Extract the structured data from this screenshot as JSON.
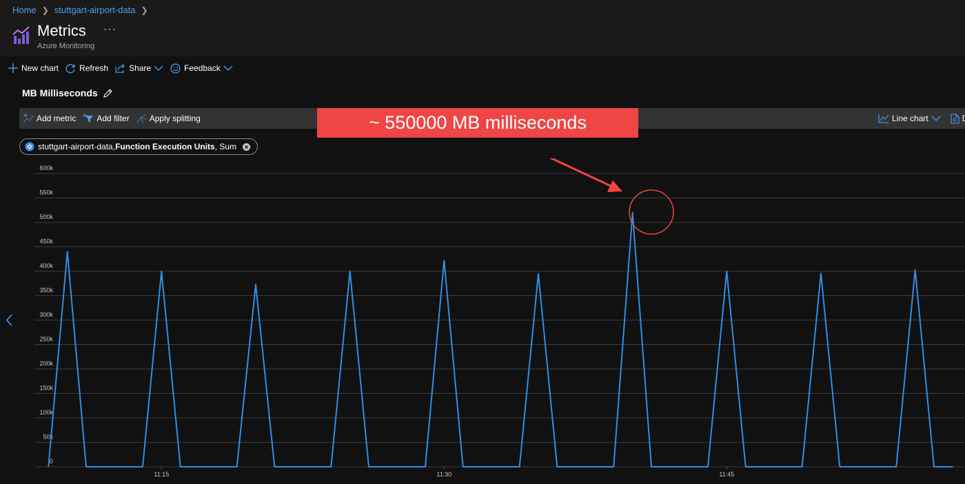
{
  "breadcrumb": {
    "home": "Home",
    "resource": "stuttgart-airport-data"
  },
  "header": {
    "title": "Metrics",
    "subtitle": "Azure Monitoring",
    "more": "···"
  },
  "commands": {
    "new_chart": "New chart",
    "refresh": "Refresh",
    "share": "Share",
    "feedback": "Feedback"
  },
  "chart_title": "MB Milliseconds",
  "toolbar": {
    "add_metric": "Add metric",
    "add_filter": "Add filter",
    "apply_splitting": "Apply splitting",
    "chart_type": "Line chart",
    "overflow_label": "D"
  },
  "metric_pill": {
    "resource": "stuttgart-airport-data,",
    "metric": "Function Execution Units",
    "aggregation": ", Sum"
  },
  "callout": {
    "text": "~ 550000 MB milliseconds"
  },
  "colors": {
    "accent": "#4aa0f0",
    "series": "#2f8fe8",
    "callout": "#f04545"
  },
  "chart_data": {
    "type": "line",
    "title": "",
    "ylim": [
      0,
      600000
    ],
    "y_ticks": [
      "0",
      "50k",
      "100k",
      "150k",
      "200k",
      "250k",
      "300k",
      "350k",
      "400k",
      "450k",
      "500k",
      "550k",
      "600k"
    ],
    "x_ticks": [
      "11:15",
      "11:30",
      "11:45"
    ],
    "x_tick_minutes": [
      15,
      30,
      45
    ],
    "grid": true,
    "series": [
      {
        "x_minutes": [
          9.0,
          10.0,
          11.0,
          12.0,
          14.0,
          15.0,
          16.0,
          17.0,
          19.0,
          20.0,
          21.0,
          22.0,
          24.0,
          25.0,
          26.0,
          27.0,
          29.0,
          30.0,
          31.0,
          32.0,
          34.0,
          35.0,
          36.0,
          37.0,
          39.0,
          40.0,
          41.0,
          42.0,
          44.0,
          45.0,
          46.0,
          47.0,
          49.0,
          50.0,
          51.0,
          52.0,
          54.0,
          55.0,
          56.0,
          57.0
        ],
        "values": [
          0,
          440000,
          0,
          0,
          0,
          400000,
          0,
          0,
          0,
          373000,
          0,
          0,
          0,
          400000,
          0,
          0,
          0,
          422000,
          0,
          0,
          0,
          395000,
          0,
          0,
          0,
          520000,
          0,
          0,
          0,
          400000,
          0,
          0,
          0,
          396000,
          0,
          0,
          0,
          403000,
          0,
          0
        ]
      }
    ]
  }
}
